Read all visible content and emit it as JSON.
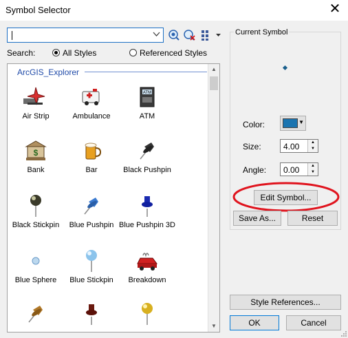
{
  "window": {
    "title": "Symbol Selector",
    "close_glyph": "✕"
  },
  "search": {
    "value": "",
    "label": "Search:",
    "option_all": "All Styles",
    "option_referenced": "Referenced Styles",
    "selected": "All Styles"
  },
  "toolbar": {
    "search_icon": "search-icon",
    "clear_icon": "clear-search-icon",
    "view_icon": "view-options-icon"
  },
  "list": {
    "group": "ArcGIS_Explorer",
    "symbols": [
      {
        "label": "Air Strip",
        "icon": "air-strip-icon"
      },
      {
        "label": "Ambulance",
        "icon": "ambulance-icon"
      },
      {
        "label": "ATM",
        "icon": "atm-icon"
      },
      {
        "label": "Bank",
        "icon": "bank-icon"
      },
      {
        "label": "Bar",
        "icon": "bar-icon"
      },
      {
        "label": "Black Pushpin",
        "icon": "black-pushpin-icon"
      },
      {
        "label": "Black Stickpin",
        "icon": "black-stickpin-icon"
      },
      {
        "label": "Blue Pushpin",
        "icon": "blue-pushpin-icon"
      },
      {
        "label": "Blue Pushpin 3D",
        "icon": "blue-pushpin-3d-icon"
      },
      {
        "label": "Blue Sphere",
        "icon": "blue-sphere-icon"
      },
      {
        "label": "Blue Stickpin",
        "icon": "blue-stickpin-icon"
      },
      {
        "label": "Breakdown",
        "icon": "breakdown-icon"
      }
    ]
  },
  "current_symbol": {
    "title": "Current Symbol",
    "color_label": "Color:",
    "color_value": "#1a74b0",
    "size_label": "Size:",
    "size_value": "4.00",
    "angle_label": "Angle:",
    "angle_value": "0.00"
  },
  "buttons": {
    "edit_symbol": "Edit Symbol...",
    "save_as": "Save As...",
    "reset": "Reset",
    "style_references": "Style References...",
    "ok": "OK",
    "cancel": "Cancel"
  },
  "colors": {
    "highlight_ellipse": "#e0141e",
    "group_header": "#1f4aa8"
  }
}
